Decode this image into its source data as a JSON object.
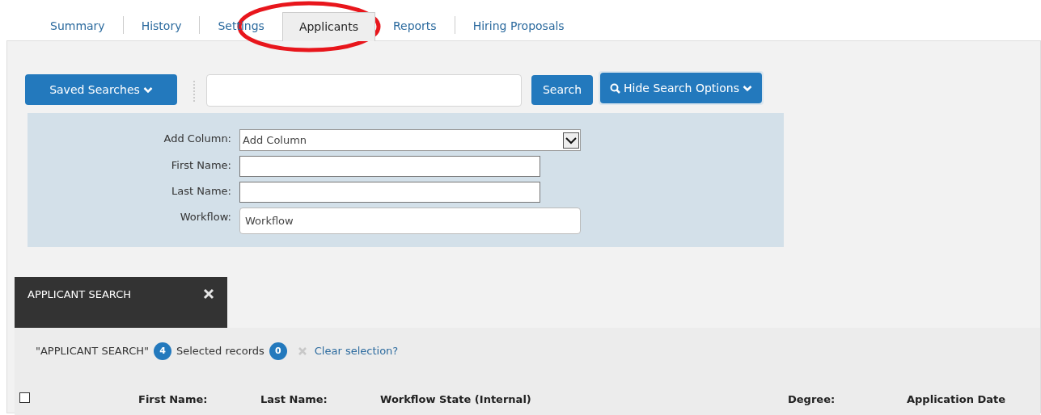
{
  "tabs": [
    {
      "label": "Summary",
      "selected": false
    },
    {
      "label": "History",
      "selected": false
    },
    {
      "label": "Settings",
      "selected": false
    },
    {
      "label": "Applicants",
      "selected": true
    },
    {
      "label": "Reports",
      "selected": false
    },
    {
      "label": "Hiring Proposals",
      "selected": false
    }
  ],
  "toolbar": {
    "saved_searches": "Saved Searches",
    "search_button": "Search",
    "options_button": "Hide Search Options"
  },
  "search_options": [
    {
      "kind": "select",
      "label": "Add Column:",
      "value": "Add Column"
    },
    {
      "kind": "text",
      "label": "First Name:"
    },
    {
      "kind": "text",
      "label": "Last Name:"
    },
    {
      "kind": "wide",
      "label": "Workflow:",
      "value": "Workflow"
    }
  ],
  "result_tab": {
    "title": "APPLICANT SEARCH"
  },
  "summary": {
    "search_name": "\"APPLICANT SEARCH\"",
    "count": "4",
    "selected_label": "Selected records",
    "selected_count": "0",
    "clear": "Clear selection?"
  },
  "table": {
    "select_all_checked": false,
    "columns": [
      "First Name:",
      "Last Name:",
      "Workflow State (Internal)",
      "Degree:",
      "Application Date"
    ]
  }
}
